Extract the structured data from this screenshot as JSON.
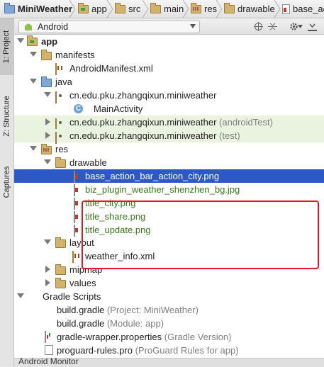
{
  "breadcrumb": {
    "items": [
      "MiniWeather",
      "app",
      "src",
      "main",
      "res",
      "drawable",
      "base_ac"
    ]
  },
  "side_tabs": {
    "project": "1: Project",
    "structure": "Z: Structure",
    "captures": "Captures"
  },
  "header": {
    "view_selector": "Android"
  },
  "tree": {
    "app": "app",
    "manifests": "manifests",
    "manifest_file": "AndroidManifest.xml",
    "java": "java",
    "pkg_main": "cn.edu.pku.zhangqixun.miniweather",
    "main_activity": "MainActivity",
    "pkg_android_test": "cn.edu.pku.zhangqixun.miniweather",
    "pkg_android_test_suffix": "(androidTest)",
    "pkg_test": "cn.edu.pku.zhangqixun.miniweather",
    "pkg_test_suffix": "(test)",
    "res": "res",
    "drawable": "drawable",
    "files": [
      "base_action_bar_action_city.png",
      "biz_plugin_weather_shenzhen_bg.jpg",
      "title_city.png",
      "title_share.png",
      "title_update.png"
    ],
    "layout": "layout",
    "weather_info": "weather_info.xml",
    "mipmap": "mipmap",
    "values": "values",
    "gradle_scripts": "Gradle Scripts",
    "build_gradle_project": "build.gradle",
    "build_gradle_project_suffix": "(Project: MiniWeather)",
    "build_gradle_module": "build.gradle",
    "build_gradle_module_suffix": "(Module: app)",
    "gradle_wrapper": "gradle-wrapper.properties",
    "gradle_wrapper_suffix": "(Gradle Version)",
    "proguard": "proguard-rules.pro",
    "proguard_suffix": "(ProGuard Rules for app)"
  },
  "bottom": {
    "monitor": "Android Monitor"
  },
  "colors": {
    "selection": "#2c58c8",
    "highlight_box": "#e0182b",
    "changed_row": "#eaf2e0"
  }
}
